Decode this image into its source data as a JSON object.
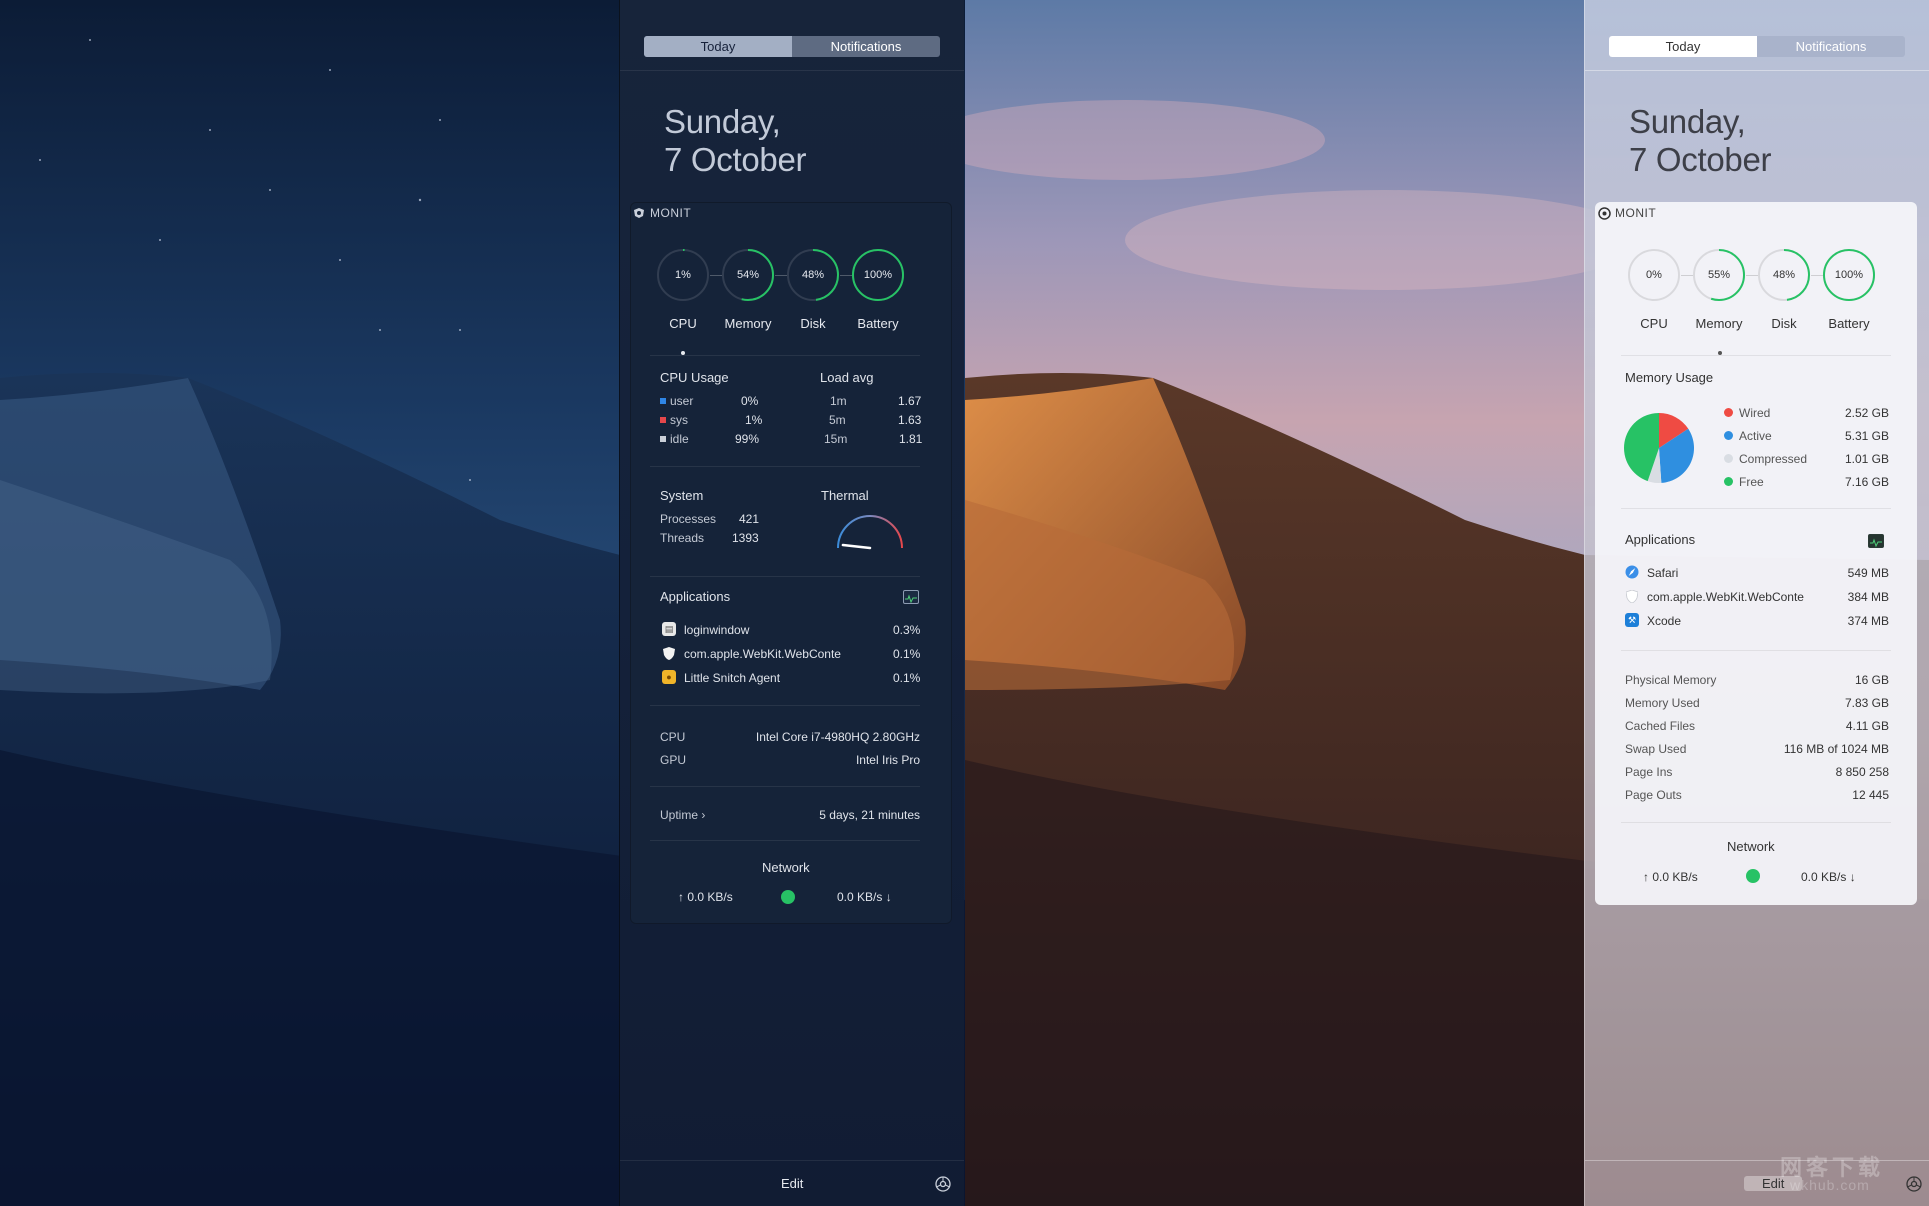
{
  "colors": {
    "gauge_green": "#27c265",
    "cpu_user": "#2f86e6",
    "cpu_sys": "#e5474b",
    "cpu_idle": "#c9cfd8",
    "mem_wired": "#ef4b43",
    "mem_active": "#2f8fe0",
    "mem_compressed": "#d9dde3",
    "mem_free": "#27c265",
    "net_dot": "#27c265"
  },
  "dark_panel": {
    "tabs": [
      {
        "label": "Today",
        "active": true
      },
      {
        "label": "Notifications",
        "active": false
      }
    ],
    "date_line1": "Sunday,",
    "date_line2": "7 October",
    "widget_title": "MONIT",
    "gauges": [
      {
        "value": "1%",
        "label": "CPU",
        "percent": 1
      },
      {
        "value": "54%",
        "label": "Memory",
        "percent": 54
      },
      {
        "value": "48%",
        "label": "Disk",
        "percent": 48
      },
      {
        "value": "100%",
        "label": "Battery",
        "percent": 100
      }
    ],
    "cpu_usage": {
      "title": "CPU Usage",
      "rows": [
        {
          "label": "user",
          "value": "0%"
        },
        {
          "label": "sys",
          "value": "1%"
        },
        {
          "label": "idle",
          "value": "99%"
        }
      ]
    },
    "load_avg": {
      "title": "Load avg",
      "rows": [
        {
          "label": "1m",
          "value": "1.67"
        },
        {
          "label": "5m",
          "value": "1.63"
        },
        {
          "label": "15m",
          "value": "1.81"
        }
      ]
    },
    "system": {
      "title": "System",
      "rows": [
        {
          "label": "Processes",
          "value": "421"
        },
        {
          "label": "Threads",
          "value": "1393"
        }
      ]
    },
    "thermal": {
      "title": "Thermal",
      "level": 0.08
    },
    "applications": {
      "title": "Applications",
      "icon": "activity-monitor-icon",
      "items": [
        {
          "name": "loginwindow",
          "value": "0.3%",
          "icon": "loginwindow-icon"
        },
        {
          "name": "com.apple.WebKit.WebConte",
          "value": "0.1%",
          "icon": "shield-icon"
        },
        {
          "name": "Little Snitch Agent",
          "value": "0.1%",
          "icon": "little-snitch-icon"
        }
      ]
    },
    "hardware": [
      {
        "label": "CPU",
        "value": "Intel Core i7-4980HQ 2.80GHz"
      },
      {
        "label": "GPU",
        "value": "Intel Iris Pro"
      }
    ],
    "uptime": {
      "label": "Uptime ›",
      "value": "5 days, 21 minutes"
    },
    "network": {
      "title": "Network",
      "up": "↑ 0.0 KB/s",
      "down": "0.0 KB/s ↓"
    },
    "edit_label": "Edit"
  },
  "light_panel": {
    "tabs": [
      {
        "label": "Today",
        "active": true
      },
      {
        "label": "Notifications",
        "active": false
      }
    ],
    "date_line1": "Sunday,",
    "date_line2": "7 October",
    "widget_title": "MONIT",
    "gauges": [
      {
        "value": "0%",
        "label": "CPU",
        "percent": 0
      },
      {
        "value": "55%",
        "label": "Memory",
        "percent": 55
      },
      {
        "value": "48%",
        "label": "Disk",
        "percent": 48
      },
      {
        "value": "100%",
        "label": "Battery",
        "percent": 100
      }
    ],
    "memory_usage": {
      "title": "Memory Usage",
      "items": [
        {
          "label": "Wired",
          "value": "2.52 GB",
          "gb": 2.52
        },
        {
          "label": "Active",
          "value": "5.31 GB",
          "gb": 5.31
        },
        {
          "label": "Compressed",
          "value": "1.01 GB",
          "gb": 1.01
        },
        {
          "label": "Free",
          "value": "7.16 GB",
          "gb": 7.16
        }
      ]
    },
    "applications": {
      "title": "Applications",
      "icon": "activity-monitor-icon",
      "items": [
        {
          "name": "Safari",
          "value": "549 MB",
          "icon": "safari-icon"
        },
        {
          "name": "com.apple.WebKit.WebConte",
          "value": "384 MB",
          "icon": "shield-icon"
        },
        {
          "name": "Xcode",
          "value": "374 MB",
          "icon": "xcode-icon"
        }
      ]
    },
    "stats": [
      {
        "label": "Physical Memory",
        "value": "16 GB"
      },
      {
        "label": "Memory Used",
        "value": "7.83 GB"
      },
      {
        "label": "Cached Files",
        "value": "4.11 GB"
      },
      {
        "label": "Swap Used",
        "value": "116 MB of 1024 MB"
      },
      {
        "label": "Page Ins",
        "value": "8 850 258"
      },
      {
        "label": "Page Outs",
        "value": "12 445"
      }
    ],
    "network": {
      "title": "Network",
      "up": "↑ 0.0 KB/s",
      "down": "0.0 KB/s ↓"
    },
    "edit_label": "Edit"
  },
  "watermark": {
    "line1": "网客下载",
    "line2": "wkhub.com"
  }
}
